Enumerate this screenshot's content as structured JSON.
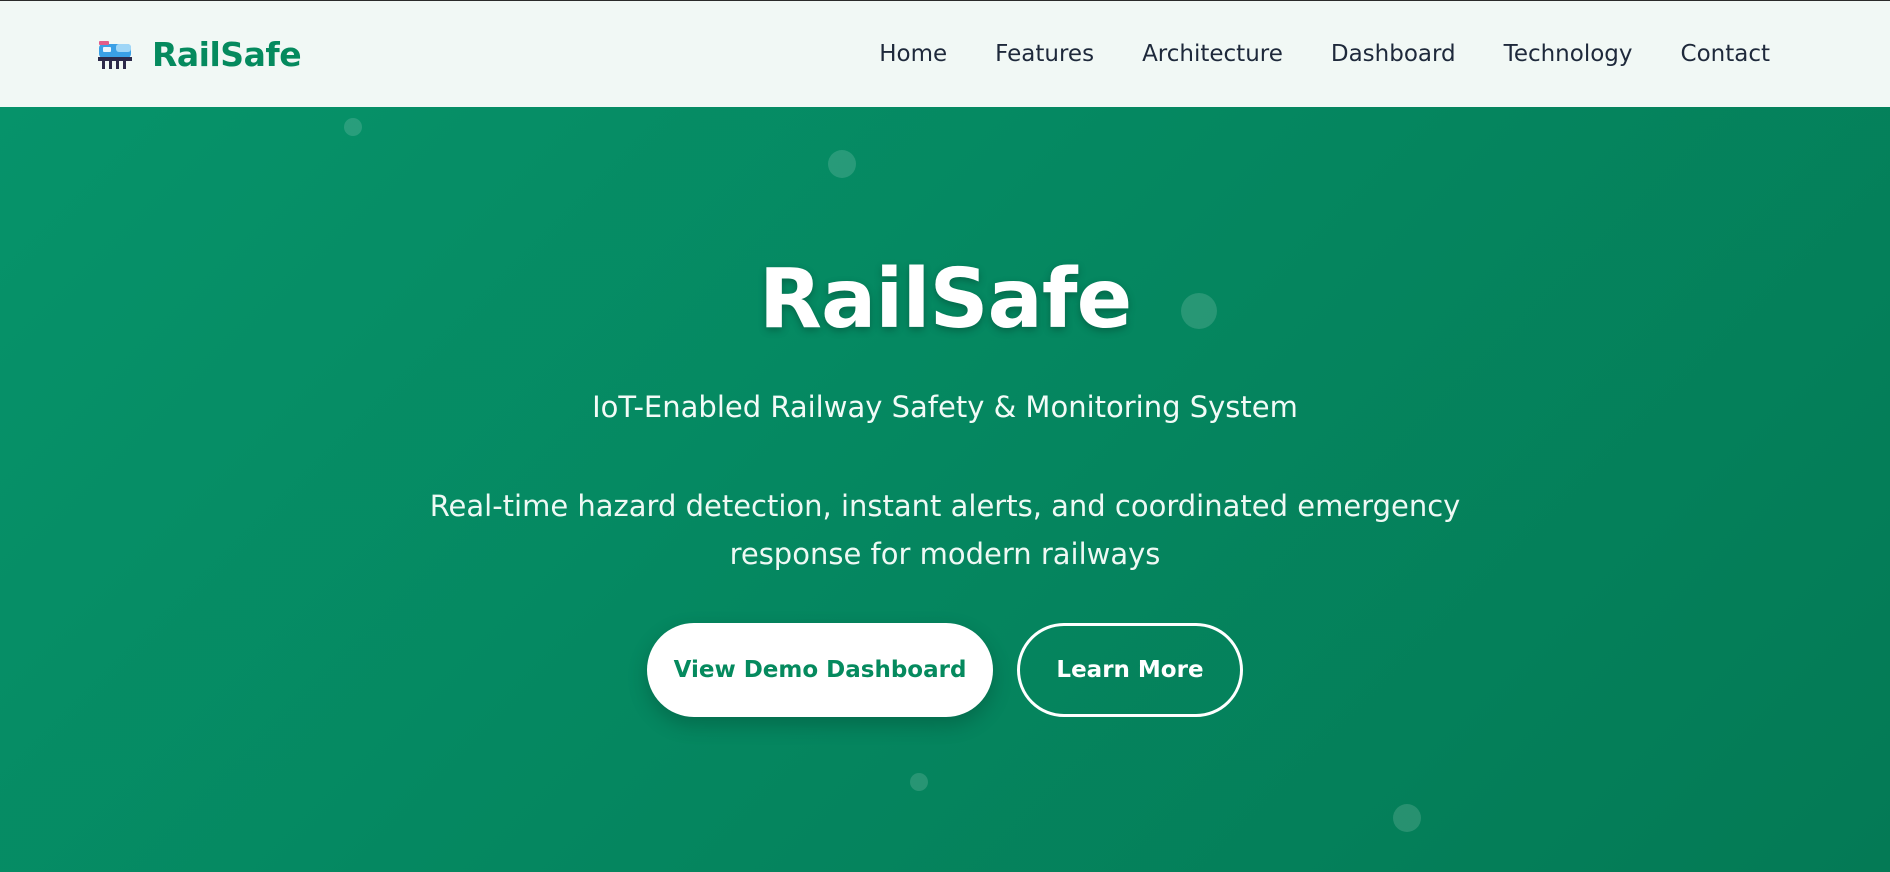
{
  "nav": {
    "brand_name": "RailSafe",
    "brand_icon": "train-icon",
    "links": [
      {
        "label": "Home"
      },
      {
        "label": "Features"
      },
      {
        "label": "Architecture"
      },
      {
        "label": "Dashboard"
      },
      {
        "label": "Technology"
      },
      {
        "label": "Contact"
      }
    ]
  },
  "hero": {
    "title": "RailSafe",
    "subtitle": "IoT-Enabled Railway Safety & Monitoring System",
    "description": "Real-time hazard detection, instant alerts, and coordinated emergency response for modern railways",
    "primary_button": "View Demo Dashboard",
    "secondary_button": "Learn More"
  },
  "colors": {
    "brand": "#058a5e",
    "hero_gradient_start": "#06936a",
    "hero_gradient_end": "#047a55",
    "nav_background": "#f1f8f5",
    "nav_text": "#1e293b"
  }
}
